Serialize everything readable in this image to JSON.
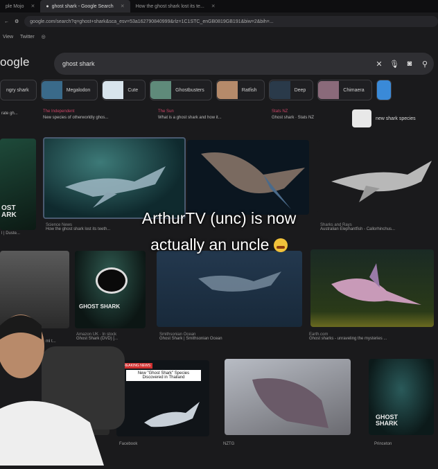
{
  "browser": {
    "tabs": [
      {
        "label": "ple Mojo",
        "active": false
      },
      {
        "label": "ghost shark - Google Search",
        "active": true
      },
      {
        "label": "How the ghost shark lost its te...",
        "active": false
      }
    ],
    "url": "google.com/search?q=ghost+shark&sca_esv=53a162790840999&rlz=1C1STC_enGB0819GB191&biw=2&bih=...",
    "bookmarks": [
      "View",
      "Twitter"
    ]
  },
  "google": {
    "logo": "oogle",
    "query": "ghost shark"
  },
  "chips": [
    {
      "label": "ngry shark",
      "color": ""
    },
    {
      "label": "Megalodon",
      "color": "#3a6a8a"
    },
    {
      "label": "Cute",
      "color": "#d8e4ec"
    },
    {
      "label": "Ghostbusters",
      "color": "#5f8a7a"
    },
    {
      "label": "Ratfish",
      "color": "#b58a6a"
    },
    {
      "label": "Deep",
      "color": "#2a3a4a"
    },
    {
      "label": "Chimaera",
      "color": "#8a6a7a"
    }
  ],
  "sources_row1": [
    {
      "site": "",
      "title": "rate gh..."
    },
    {
      "site": "The Independent",
      "title": "New species of otherworldly ghos..."
    },
    {
      "site": "The Sun",
      "title": "What is a ghost shark and how it..."
    },
    {
      "site": "Stats NZ",
      "title": "Ghost shark · Stats NZ"
    }
  ],
  "new_species_label": "new shark species",
  "row1_captions": [
    {
      "site": "",
      "title": "l | Duste..."
    },
    {
      "site": "Science News",
      "title": "How the ghost shark lost its teeth..."
    },
    {
      "site": "Sharks and Rays",
      "title": "Australian Elephantfish - Callorhinchus..."
    }
  ],
  "row2_captions": [
    {
      "site": "Amazon UK · In stock",
      "title": "Ghost Shark (DVD) [..."
    },
    {
      "site": "Smithsonian Ocean",
      "title": "Ghost Shark | Smithsonian Ocean"
    },
    {
      "site": "Earth.com",
      "title": "Ghost sharks - unraveling the mysteries ..."
    }
  ],
  "row1_left_caption": "ml t...",
  "posters": {
    "left": "OST\nARK",
    "middle": "GHOST SHARK",
    "right": "GHOST\nSHARK"
  },
  "news_card": {
    "badge": "BREAKING NEWS",
    "headline": "New \"Ghost Shark\" Species Discovered in Thailand"
  },
  "bottom_captions": [
    "Facebook",
    "NZTG",
    "Princeton"
  ],
  "overlay": {
    "line1": "ArthurTV (unc) is now",
    "line2": "actually an uncle"
  }
}
